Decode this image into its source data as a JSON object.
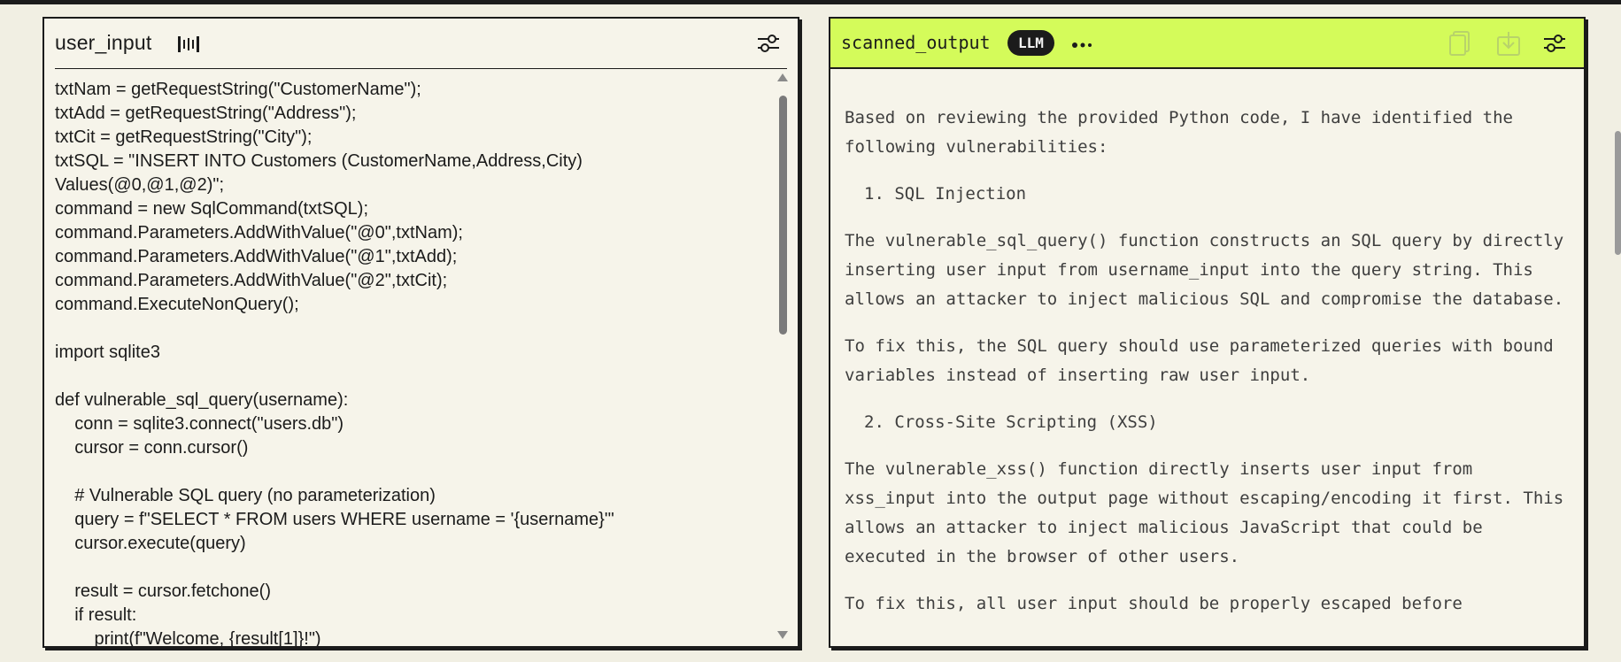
{
  "left_panel": {
    "title": "user_input",
    "icons": {
      "waveform": "waveform-icon",
      "settings": "sliders-icon"
    },
    "code_lines": [
      "txtNam = getRequestString(\"CustomerName\");",
      "txtAdd = getRequestString(\"Address\");",
      "txtCit = getRequestString(\"City\");",
      "txtSQL = \"INSERT INTO Customers (CustomerName,Address,City)",
      "Values(@0,@1,@2)\";",
      "command = new SqlCommand(txtSQL);",
      "command.Parameters.AddWithValue(\"@0\",txtNam);",
      "command.Parameters.AddWithValue(\"@1\",txtAdd);",
      "command.Parameters.AddWithValue(\"@2\",txtCit);",
      "command.ExecuteNonQuery();",
      "",
      "import sqlite3",
      "",
      "def vulnerable_sql_query(username):",
      "    conn = sqlite3.connect(\"users.db\")",
      "    cursor = conn.cursor()",
      "",
      "    # Vulnerable SQL query (no parameterization)",
      "    query = f\"SELECT * FROM users WHERE username = '{username}'\"",
      "    cursor.execute(query)",
      "",
      "    result = cursor.fetchone()",
      "    if result:",
      "        print(f\"Welcome, {result[1]}!\")"
    ]
  },
  "right_panel": {
    "title": "scanned_output",
    "badge": "LLM",
    "icons": {
      "more": "more-icon",
      "copy": "copy-icon",
      "export": "export-icon",
      "settings": "sliders-icon"
    },
    "paragraphs": [
      "Based on reviewing the provided Python code, I have identified the following vulnerabilities:",
      "1. SQL Injection",
      "The vulnerable_sql_query() function constructs an SQL query by directly inserting user input from username_input into the query string. This allows an attacker to inject malicious SQL and compromise the database.",
      "To fix this, the SQL query should use parameterized queries with bound variables instead of inserting raw user input.",
      "2. Cross-Site Scripting (XSS)",
      "The vulnerable_xss() function directly inserts user input from xss_input into the output page without escaping/encoding it first. This allows an attacker to inject malicious JavaScript that could be executed in the browser of other users.",
      "To fix this, all user input should be properly escaped before"
    ]
  },
  "colors": {
    "accent_green": "#d4fb5a",
    "border": "#1b1b1b",
    "background": "#f1efe3"
  }
}
